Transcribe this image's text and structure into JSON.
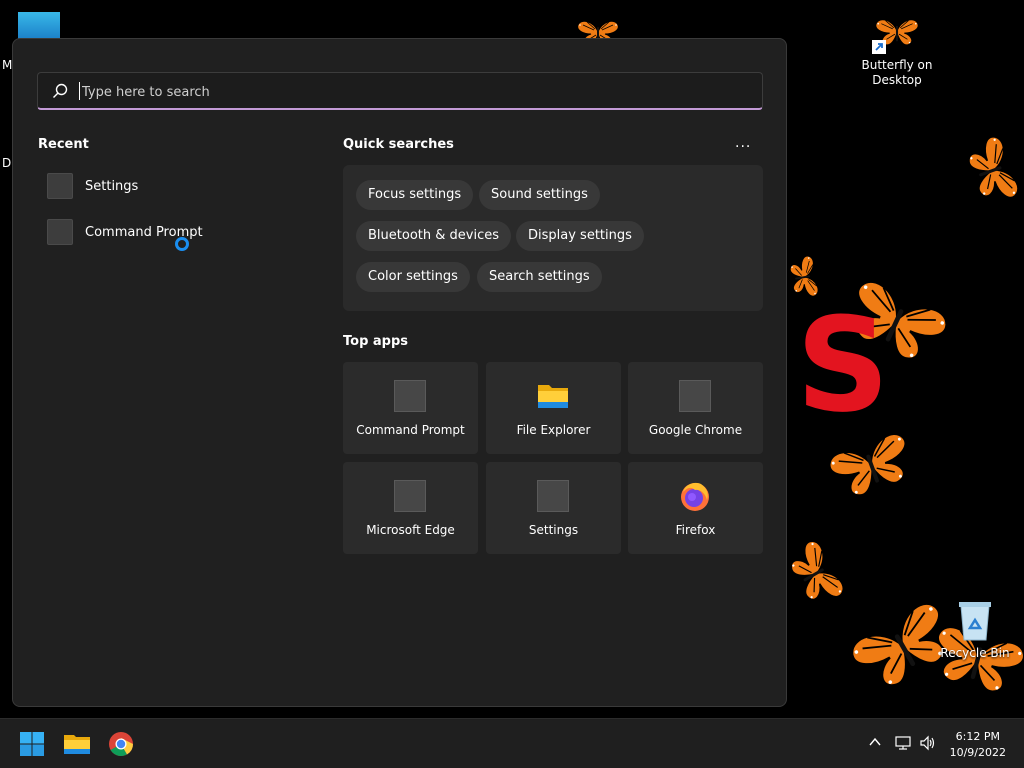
{
  "desktop": {
    "edge_label_1": "M",
    "edge_label_2": "Da",
    "shortcut_label": "Butterfly on Desktop",
    "recycle_bin_label": "Recycle Bin",
    "big_letter": "S"
  },
  "start_menu": {
    "search": {
      "placeholder": "Type here to search",
      "value": ""
    },
    "recent": {
      "title": "Recent",
      "items": [
        {
          "label": "Settings",
          "icon": "settings-app-icon"
        },
        {
          "label": "Command Prompt",
          "icon": "command-prompt-icon"
        }
      ]
    },
    "quick_searches": {
      "title": "Quick searches",
      "more_label": "...",
      "chips": [
        "Focus settings",
        "Sound settings",
        "Bluetooth & devices",
        "Display settings",
        "Color settings",
        "Search settings"
      ]
    },
    "top_apps": {
      "title": "Top apps",
      "items": [
        {
          "label": "Command Prompt",
          "icon": "command-prompt-icon"
        },
        {
          "label": "File Explorer",
          "icon": "folder-icon"
        },
        {
          "label": "Google Chrome",
          "icon": "chrome-icon"
        },
        {
          "label": "Microsoft Edge",
          "icon": "edge-icon"
        },
        {
          "label": "Settings",
          "icon": "settings-app-icon"
        },
        {
          "label": "Firefox",
          "icon": "firefox-icon"
        }
      ]
    }
  },
  "taskbar": {
    "apps": [
      "windows-start-icon",
      "file-explorer-icon",
      "chrome-icon"
    ],
    "tray": [
      "chevron-up-icon",
      "network-icon",
      "volume-icon"
    ],
    "time": "6:12 PM",
    "date": "10/9/2022"
  },
  "colors": {
    "menu_bg": "#202020",
    "panel_bg": "#2a2a2a",
    "accent_underline": "#c39ad6",
    "spinner": "#1a8ef0",
    "butterfly": "#f07c14",
    "big_letter": "#e3141f"
  }
}
